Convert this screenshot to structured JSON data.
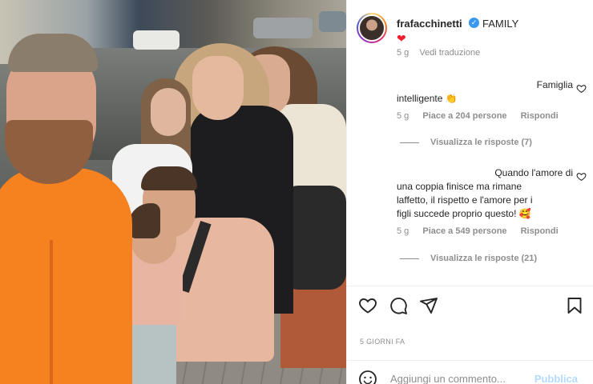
{
  "post": {
    "username": "frafacchinetti",
    "caption": "FAMILY",
    "caption_emoji": "❤",
    "time_ago": "5 g",
    "see_translation": "Vedi traduzione",
    "posted_label": "5 GIORNI FA"
  },
  "comments": [
    {
      "text_line1": "Famiglia",
      "text_line2": "intelligente 👏",
      "time": "5 g",
      "likes": "Piace a 204 persone",
      "reply": "Rispondi",
      "view_replies": "Visualizza le risposte (7)"
    },
    {
      "text_line1": "Quando l'amore di",
      "text_line2": "una coppia finisce ma rimane",
      "text_line3": "laffetto, il rispetto e l'amore per i",
      "text_line4": "figli succede proprio questo! 🥰",
      "time": "5 g",
      "likes": "Piace a 549 persone",
      "reply": "Rispondi",
      "view_replies": "Visualizza le risposte (21)"
    }
  ],
  "add_comment": {
    "placeholder": "Aggiungi un commento...",
    "publish_label": "Pubblica"
  },
  "icons": {
    "verified": "verified-badge-icon",
    "like": "heart-icon",
    "comment": "comment-icon",
    "share": "share-icon",
    "save": "bookmark-icon",
    "emoji": "emoji-icon"
  },
  "colors": {
    "verified": "#3897f0",
    "heart": "#ed1f2d",
    "publish_disabled": "#b3dbff",
    "muted_text": "#8e8e8e"
  }
}
